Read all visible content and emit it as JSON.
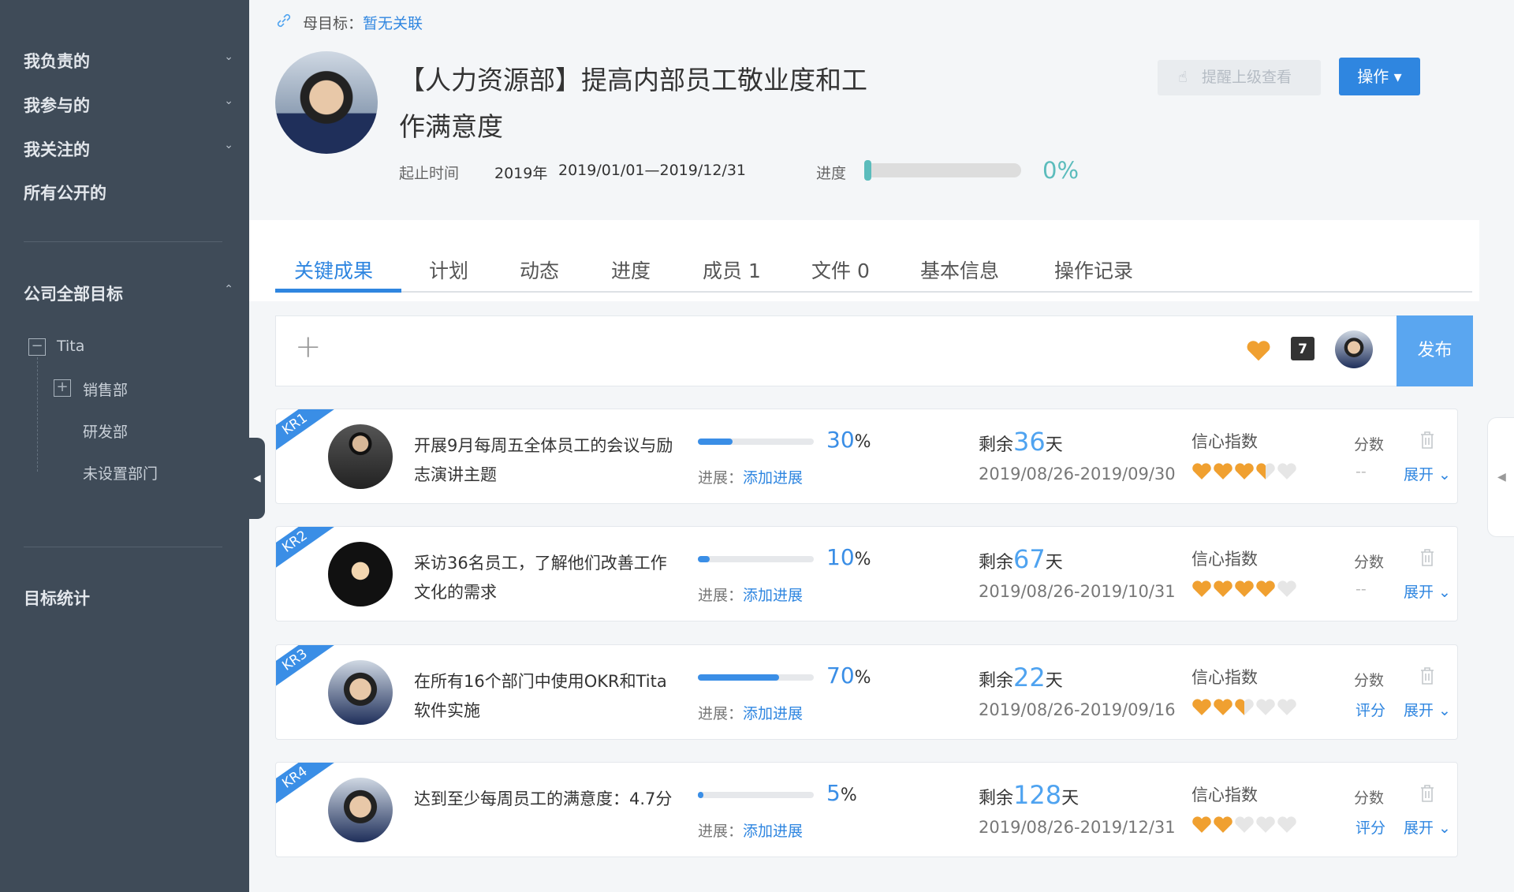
{
  "sidebar": {
    "items": [
      {
        "label": "我负责的",
        "chev": "⌄"
      },
      {
        "label": "我参与的",
        "chev": "⌄"
      },
      {
        "label": "我关注的",
        "chev": "⌄"
      },
      {
        "label": "所有公开的"
      }
    ],
    "company": {
      "label": "公司全部目标",
      "chev": "⌃"
    },
    "tree": [
      {
        "label": "Tita",
        "toggle": "−"
      },
      {
        "label": "销售部",
        "toggle": "+"
      },
      {
        "label": "研发部"
      },
      {
        "label": "未设置部门"
      }
    ],
    "stats": "目标统计",
    "collapse_icon": "◀"
  },
  "header": {
    "parent_label": "母目标：",
    "parent_value": "暂无关联",
    "title_line1": "【人力资源部】提高内部员工敬业度和工",
    "title_line2": "作满意度",
    "time_label": "起止时间",
    "year": "2019年",
    "range": "2019/01/01—2019/12/31",
    "progress_label": "进度",
    "progress_value": "0%",
    "progress": 0,
    "remind_button": "提醒上级查看",
    "action_button": "操作 ▾"
  },
  "tabs": [
    {
      "label": "关键成果"
    },
    {
      "label": "计划"
    },
    {
      "label": "动态"
    },
    {
      "label": "进度"
    },
    {
      "label": "成员 1"
    },
    {
      "label": "文件 0"
    },
    {
      "label": "基本信息"
    },
    {
      "label": "操作记录"
    }
  ],
  "composer": {
    "add_icon": "+",
    "calendar_day": "7",
    "publish": "发布"
  },
  "krs": [
    {
      "tag": "KR1",
      "title": "开展9月每周五全体员工的会议与励志演讲主题",
      "progress": 30,
      "pct": "30",
      "pct_unit": "%",
      "prog_label": "进展：",
      "prog_link": "添加进展",
      "rem_pre": "剩余",
      "rem_days": "36",
      "rem_post": "天",
      "date": "2019/08/26-2019/09/30",
      "conf_label": "信心指数",
      "confidence": 3.5,
      "score_label": "分数",
      "score": "--",
      "expand": "展开 ⌄"
    },
    {
      "tag": "KR2",
      "title": "采访36名员工，了解他们改善工作文化的需求",
      "progress": 10,
      "pct": "10",
      "pct_unit": "%",
      "prog_label": "进展：",
      "prog_link": "添加进展",
      "rem_pre": "剩余",
      "rem_days": "67",
      "rem_post": "天",
      "date": "2019/08/26-2019/10/31",
      "conf_label": "信心指数",
      "confidence": 4,
      "score_label": "分数",
      "score": "--",
      "expand": "展开 ⌄"
    },
    {
      "tag": "KR3",
      "title": "在所有16个部门中使用OKR和Tita软件实施",
      "progress": 70,
      "pct": "70",
      "pct_unit": "%",
      "prog_label": "进展：",
      "prog_link": "添加进展",
      "rem_pre": "剩余",
      "rem_days": "22",
      "rem_post": "天",
      "date": "2019/08/26-2019/09/16",
      "conf_label": "信心指数",
      "confidence": 2.5,
      "score_label": "分数",
      "score": "评分",
      "expand": "展开 ⌄"
    },
    {
      "tag": "KR4",
      "title": "达到至少每周员工的满意度：4.7分",
      "progress": 5,
      "pct": "5",
      "pct_unit": "%",
      "prog_label": "进展：",
      "prog_link": "添加进展",
      "rem_pre": "剩余",
      "rem_days": "128",
      "rem_post": "天",
      "date": "2019/08/26-2019/12/31",
      "conf_label": "信心指数",
      "confidence": 2,
      "score_label": "分数",
      "score": "评分",
      "expand": "展开 ⌄"
    }
  ],
  "colors": {
    "accent": "#3a8ee6",
    "sidebar": "#3f4b58",
    "heart": "#f0a030",
    "progress_teal": "#5bbcbc"
  }
}
